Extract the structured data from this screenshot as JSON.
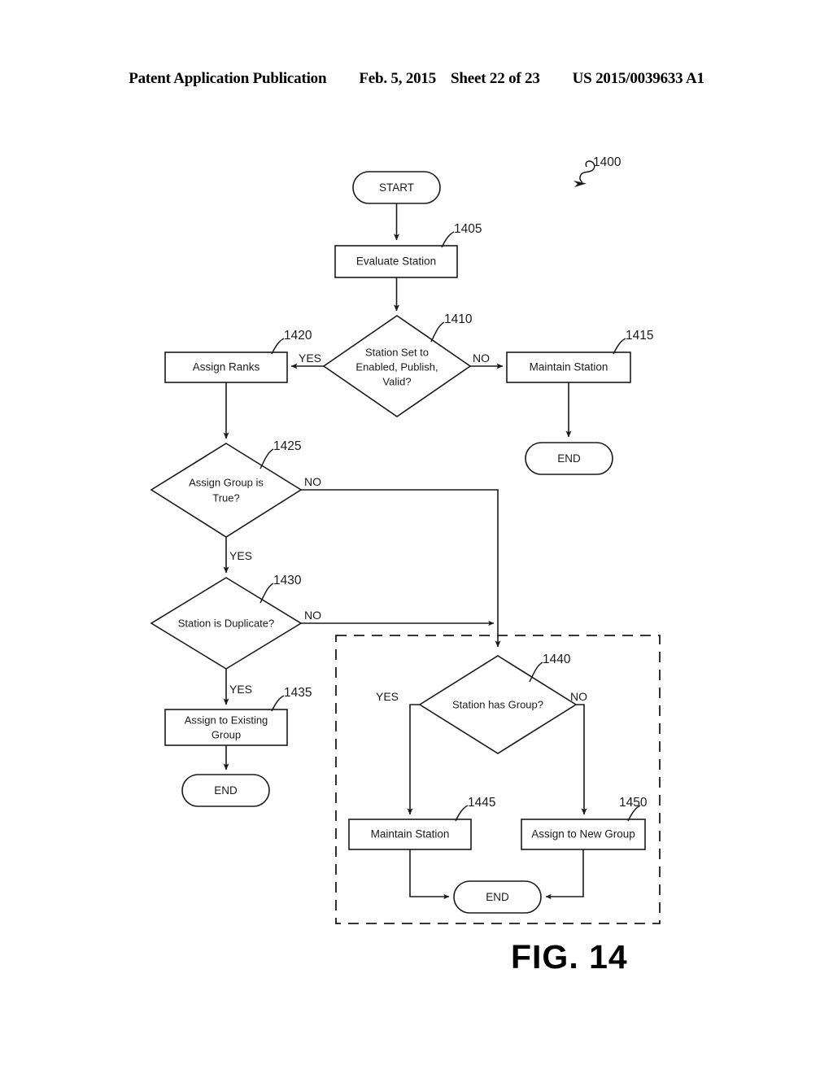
{
  "header": {
    "publication": "Patent Application Publication",
    "date": "Feb. 5, 2015",
    "sheet": "Sheet 22 of 23",
    "patent_number": "US 2015/0039633 A1"
  },
  "figure": {
    "caption": "FIG. 14",
    "diagram_reference": "1400"
  },
  "nodes": {
    "start": {
      "label": "START",
      "type": "terminal"
    },
    "evaluate_station": {
      "label": "Evaluate Station",
      "ref": "1405",
      "type": "process"
    },
    "decision_enabled": {
      "label_line1": "Station Set to",
      "label_line2": "Enabled, Publish,",
      "label_line3": "Valid?",
      "ref": "1410",
      "type": "decision"
    },
    "maintain_station_top": {
      "label": "Maintain Station",
      "ref": "1415",
      "type": "process"
    },
    "assign_ranks": {
      "label": "Assign Ranks",
      "ref": "1420",
      "type": "process"
    },
    "end_top_right": {
      "label": "END",
      "type": "terminal"
    },
    "decision_assign_group": {
      "label_line1": "Assign Group is",
      "label_line2": "True?",
      "ref": "1425",
      "type": "decision"
    },
    "decision_duplicate": {
      "label": "Station is Duplicate?",
      "ref": "1430",
      "type": "decision"
    },
    "assign_existing_group": {
      "label_line1": "Assign to Existing",
      "label_line2": "Group",
      "ref": "1435",
      "type": "process"
    },
    "end_left": {
      "label": "END",
      "type": "terminal"
    },
    "decision_has_group": {
      "label": "Station has Group?",
      "ref": "1440",
      "type": "decision"
    },
    "maintain_station_bottom": {
      "label": "Maintain Station",
      "ref": "1445",
      "type": "process"
    },
    "assign_new_group": {
      "label": "Assign to New Group",
      "ref": "1450",
      "type": "process"
    },
    "end_bottom": {
      "label": "END",
      "type": "terminal"
    }
  },
  "branch_labels": {
    "enabled_yes": "YES",
    "enabled_no": "NO",
    "assign_group_no": "NO",
    "assign_group_yes": "YES",
    "duplicate_no": "NO",
    "duplicate_yes": "YES",
    "has_group_yes": "YES",
    "has_group_no": "NO"
  },
  "colors": {
    "ink": "#1a1a1a",
    "paper": "#ffffff"
  }
}
